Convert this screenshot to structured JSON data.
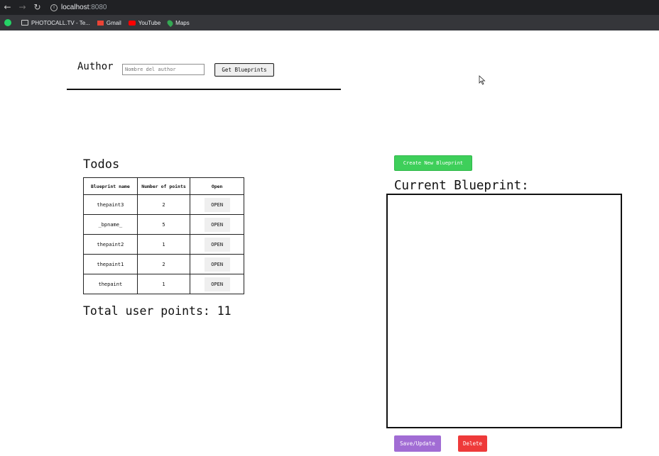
{
  "browser": {
    "url_host": "localhost",
    "url_port": ":8080",
    "bookmarks": [
      {
        "label": "",
        "icon": "whatsapp-icon"
      },
      {
        "label": "PHOTOCALL.TV - Te...",
        "icon": "folder-icon"
      },
      {
        "label": "Gmail",
        "icon": "gmail-icon"
      },
      {
        "label": "YouTube",
        "icon": "youtube-icon"
      },
      {
        "label": "Maps",
        "icon": "maps-icon"
      }
    ]
  },
  "author": {
    "label": "Author",
    "input_value": "",
    "input_placeholder": "Nombre del author",
    "button_label": "Get Blueprints"
  },
  "blueprints": {
    "title": "Todos",
    "columns": [
      "Blueprint name",
      "Number of points",
      "Open"
    ],
    "rows": [
      {
        "name": "thepaint3",
        "points": "2",
        "open_label": "OPEN"
      },
      {
        "name": "_bpname_",
        "points": "5",
        "open_label": "OPEN"
      },
      {
        "name": "thepaint2",
        "points": "1",
        "open_label": "OPEN"
      },
      {
        "name": "thepaint1",
        "points": "2",
        "open_label": "OPEN"
      },
      {
        "name": "thepaint",
        "points": "1",
        "open_label": "OPEN"
      }
    ],
    "total_label": "Total user points: 11"
  },
  "editor": {
    "create_label": "Create New Blueprint",
    "current_title": "Current Blueprint:",
    "save_label": "Save/Update",
    "delete_label": "Delete"
  },
  "colors": {
    "create_button": "#3ecf5a",
    "save_button": "#a16cd4",
    "delete_button": "#ee3a3a",
    "browser_toolbar": "#202124",
    "bookmarks_bar": "#35363a"
  }
}
